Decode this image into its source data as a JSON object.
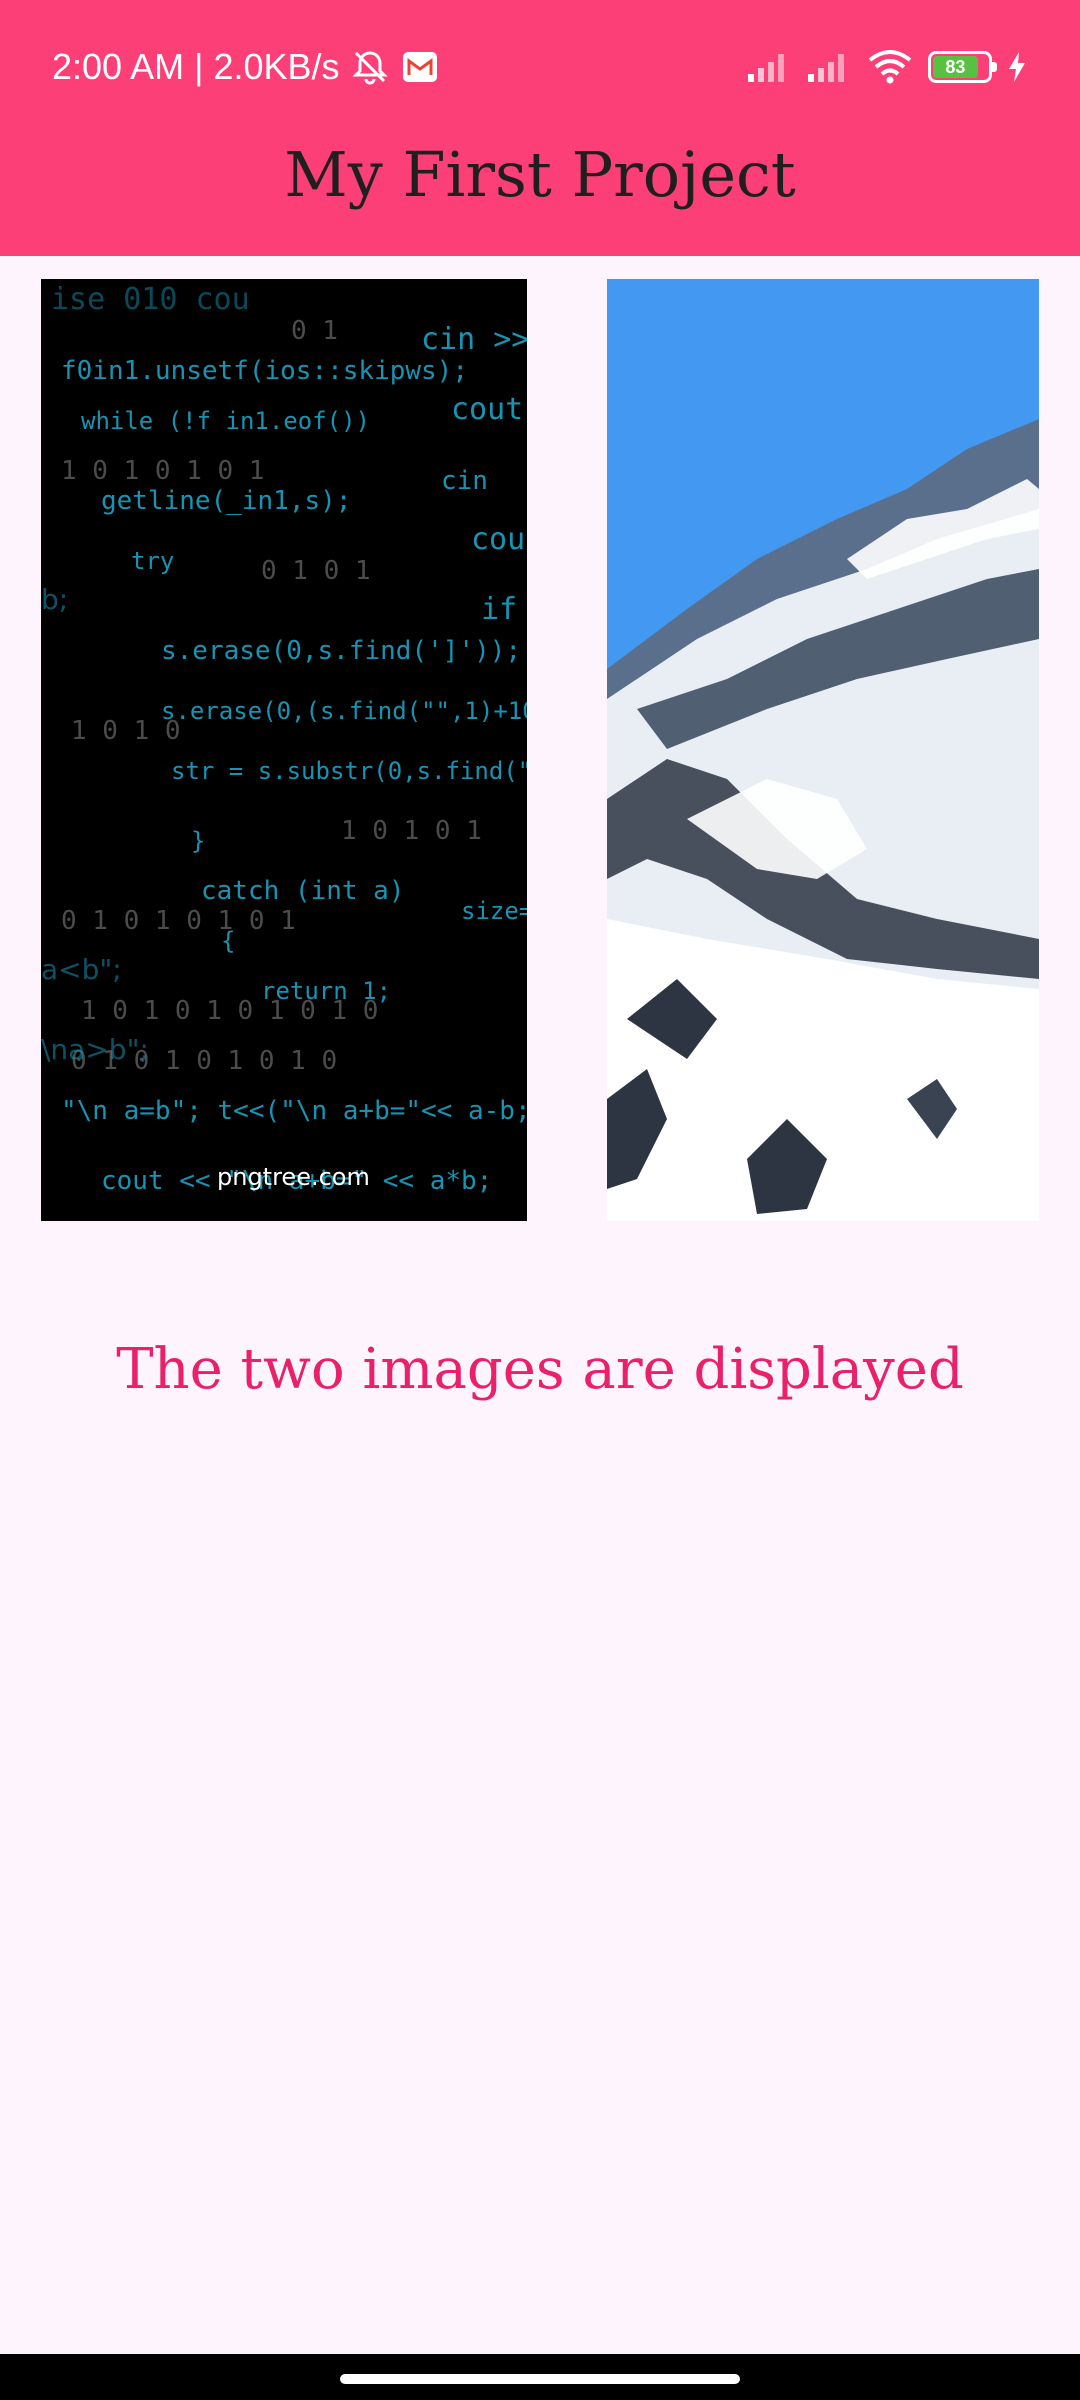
{
  "status_bar": {
    "time_speed": "2:00 AM | 2.0KB/s",
    "battery_level": "83",
    "icons": [
      "alarm-off-icon",
      "gmail-icon",
      "signal-icon",
      "signal-icon",
      "wifi-icon",
      "battery-icon",
      "charging-icon"
    ]
  },
  "app_bar": {
    "title": "My First Project",
    "color": "#fd3f77"
  },
  "images": {
    "left_watermark": "pngtree.com"
  },
  "caption": "The two images are displayed",
  "caption_color": "#e8216a"
}
